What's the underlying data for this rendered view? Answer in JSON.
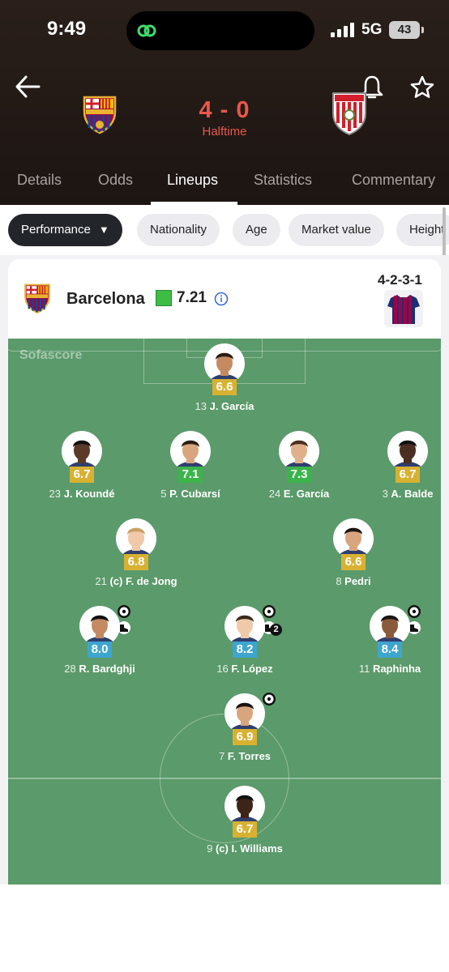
{
  "status_bar": {
    "time": "9:49",
    "network": "5G",
    "battery": "43"
  },
  "match": {
    "home_team": "Barcelona",
    "away_team": "Athletic Club",
    "score": "4 - 0",
    "status": "Halftime"
  },
  "tabs": [
    {
      "label": "Details"
    },
    {
      "label": "Odds"
    },
    {
      "label": "Lineups",
      "active": true
    },
    {
      "label": "Statistics"
    },
    {
      "label": "Commentary"
    }
  ],
  "filters": [
    {
      "label": "Performance",
      "active": true
    },
    {
      "label": "Nationality"
    },
    {
      "label": "Age"
    },
    {
      "label": "Market value"
    },
    {
      "label": "Height"
    }
  ],
  "lineup": {
    "team_name": "Barcelona",
    "team_rating": "7.21",
    "formation": "4-2-3-1",
    "watermark": "Sofascore",
    "players": [
      {
        "number": "13",
        "name": "J. García",
        "rating": "6.6",
        "rating_color": "yellow"
      },
      {
        "number": "23",
        "name": "J. Koundé",
        "rating": "6.7",
        "rating_color": "yellow"
      },
      {
        "number": "5",
        "name": "P. Cubarsí",
        "rating": "7.1",
        "rating_color": "green"
      },
      {
        "number": "24",
        "name": "E. García",
        "rating": "7.3",
        "rating_color": "green"
      },
      {
        "number": "3",
        "name": "A. Balde",
        "rating": "6.7",
        "rating_color": "yellow"
      },
      {
        "number": "21",
        "name": "(c) F. de Jong",
        "rating": "6.8",
        "rating_color": "yellow"
      },
      {
        "number": "8",
        "name": "Pedri",
        "rating": "6.6",
        "rating_color": "yellow"
      },
      {
        "number": "28",
        "name": "R. Bardghji",
        "rating": "8.0",
        "rating_color": "blue",
        "goal": true,
        "assist": true
      },
      {
        "number": "16",
        "name": "F. López",
        "rating": "8.2",
        "rating_color": "blue",
        "goal": true,
        "assist": true,
        "assist_count": "2"
      },
      {
        "number": "11",
        "name": "Raphinha",
        "rating": "8.4",
        "rating_color": "blue",
        "goal": true,
        "assist": true
      },
      {
        "number": "7",
        "name": "F. Torres",
        "rating": "6.9",
        "rating_color": "yellow",
        "goal": true
      },
      {
        "number": "9",
        "name": "(c) I. Williams",
        "rating": "6.7",
        "rating_color": "yellow"
      }
    ]
  },
  "colors": {
    "header_bg": "#1f1714",
    "score_red": "#e8574b",
    "pitch_green": "#5b9a6a",
    "rating_yellow": "#d8b133",
    "rating_green": "#3bb54b",
    "rating_blue": "#3ea5cf"
  }
}
